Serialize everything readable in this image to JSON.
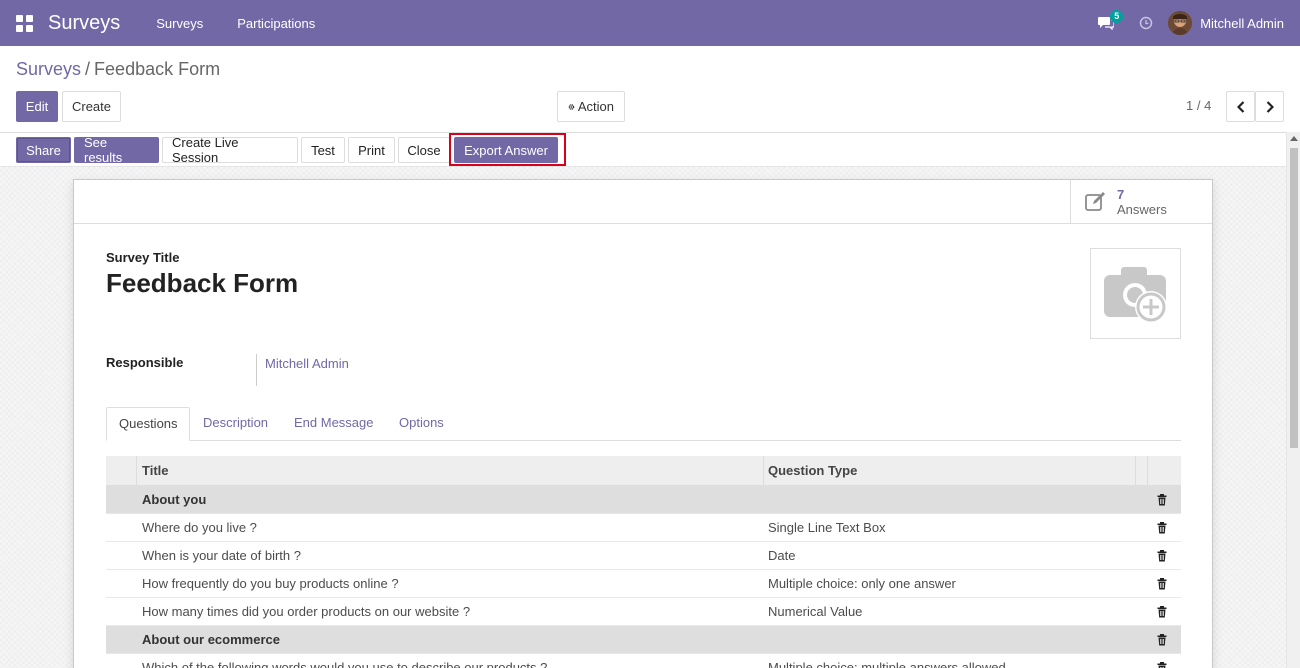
{
  "navbar": {
    "brand": "Surveys",
    "menu": [
      "Surveys",
      "Participations"
    ],
    "message_count": "5",
    "user_name": "Mitchell Admin"
  },
  "breadcrumb": {
    "parent": "Surveys",
    "separator": "/",
    "current": "Feedback Form"
  },
  "control": {
    "edit_label": "Edit",
    "create_label": "Create",
    "action_label": "Action",
    "pager": "1 / 4"
  },
  "statusbar": {
    "share": "Share",
    "see_results": "See results",
    "live_session": "Create Live Session",
    "test": "Test",
    "print": "Print",
    "close": "Close",
    "export_answer": "Export Answer"
  },
  "smart_button": {
    "count": "7",
    "label": "Answers"
  },
  "form": {
    "title_label": "Survey Title",
    "title_value": "Feedback Form",
    "responsible_label": "Responsible",
    "responsible_value": "Mitchell Admin"
  },
  "tabs": [
    "Questions",
    "Description",
    "End Message",
    "Options"
  ],
  "questions_table": {
    "headers": [
      "Title",
      "Question Type"
    ],
    "rows": [
      {
        "title": "About you",
        "type": "",
        "section": true
      },
      {
        "title": "Where do you live ?",
        "type": "Single Line Text Box",
        "section": false
      },
      {
        "title": "When is your date of birth ?",
        "type": "Date",
        "section": false
      },
      {
        "title": "How frequently do you buy products online ?",
        "type": "Multiple choice: only one answer",
        "section": false
      },
      {
        "title": "How many times did you order products on our website ?",
        "type": "Numerical Value",
        "section": false
      },
      {
        "title": "About our ecommerce",
        "type": "",
        "section": true
      },
      {
        "title": "Which of the following words would you use to describe our products ?",
        "type": "Multiple choice: multiple answers allowed",
        "section": false
      }
    ]
  },
  "colors": {
    "brand": "#7268a6",
    "highlight": "#d9001b"
  }
}
